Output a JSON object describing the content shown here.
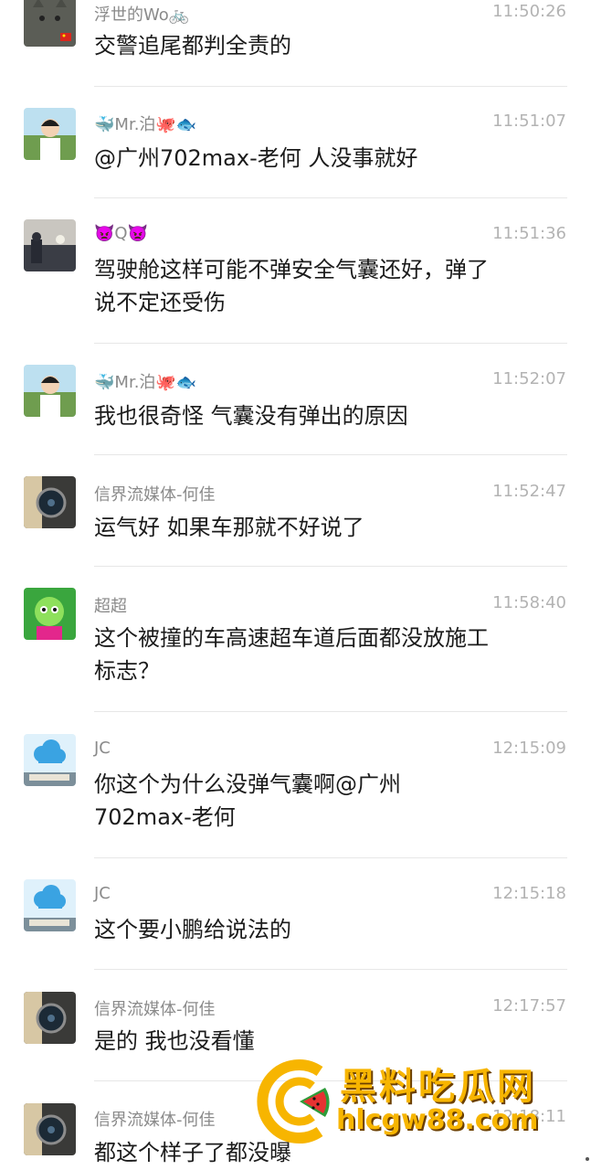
{
  "comments": [
    {
      "name": "浮世的Wo🚲",
      "time": "11:50:26",
      "text": "交警追尾都判全责的"
    },
    {
      "name": "🐳Mr.泊🐙🐟",
      "time": "11:51:07",
      "text": "@广州702max-老何 人没事就好"
    },
    {
      "name": "👿Q👿",
      "time": "11:51:36",
      "text": "驾驶舱这样可能不弹安全气囊还好，弹了\n说不定还受伤"
    },
    {
      "name": "🐳Mr.泊🐙🐟",
      "time": "11:52:07",
      "text": "我也很奇怪 气囊没有弹出的原因"
    },
    {
      "name": "信界流媒体-何佳",
      "time": "11:52:47",
      "text": "运气好  如果车那就不好说了"
    },
    {
      "name": "超超",
      "time": "11:58:40",
      "text": "这个被撞的车高速超车道后面都没放施工\n标志？"
    },
    {
      "name": "JC",
      "time": "12:15:09",
      "text": "你这个为什么没弹气囊啊@广州\n702max-老何"
    },
    {
      "name": "JC",
      "time": "12:15:18",
      "text": "这个要小鹏给说法的"
    },
    {
      "name": "信界流媒体-何佳",
      "time": "12:17:57",
      "text": "是的   我也没看懂"
    },
    {
      "name": "信界流媒体-何佳",
      "time": "12:18:11",
      "text": "都这个样子了都没曝"
    }
  ],
  "avatars": [
    "cat-avatar",
    "boy-avatar",
    "sunset-avatar",
    "boy-avatar",
    "watch-avatar",
    "cartoon-avatar",
    "cloud-avatar",
    "cloud-avatar",
    "watch-avatar",
    "watch-avatar"
  ],
  "watermark": {
    "title": "黑料吃瓜网",
    "url": "hlcgw88.com"
  },
  "colors": {
    "name": "#8a8a8a",
    "time": "#b3b3b3",
    "text": "#1b1b1b",
    "divider": "#e7e7e7",
    "watermark": "#f7b500"
  }
}
